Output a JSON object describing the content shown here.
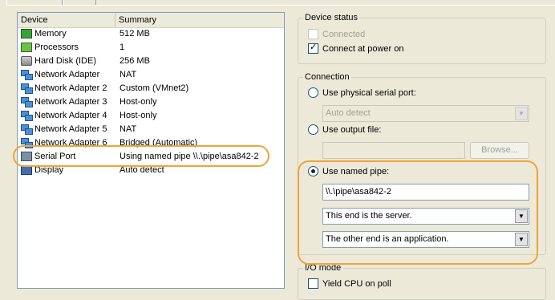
{
  "device_list": {
    "columns": [
      "Device",
      "Summary"
    ],
    "rows": [
      {
        "device": "Memory",
        "summary": "512 MB",
        "icon": "memory-icon"
      },
      {
        "device": "Processors",
        "summary": "1",
        "icon": "processor-icon"
      },
      {
        "device": "Hard Disk (IDE)",
        "summary": "256 MB",
        "icon": "hard-disk-icon"
      },
      {
        "device": "Network Adapter",
        "summary": "NAT",
        "icon": "network-adapter-icon"
      },
      {
        "device": "Network Adapter 2",
        "summary": "Custom (VMnet2)",
        "icon": "network-adapter-icon"
      },
      {
        "device": "Network Adapter 3",
        "summary": "Host-only",
        "icon": "network-adapter-icon"
      },
      {
        "device": "Network Adapter 4",
        "summary": "Host-only",
        "icon": "network-adapter-icon"
      },
      {
        "device": "Network Adapter 5",
        "summary": "NAT",
        "icon": "network-adapter-icon"
      },
      {
        "device": "Network Adapter 6",
        "summary": "Bridged (Automatic)",
        "icon": "network-adapter-icon"
      },
      {
        "device": "Serial Port",
        "summary": "Using named pipe \\\\.\\pipe\\asa842-2",
        "icon": "serial-port-icon"
      },
      {
        "device": "Display",
        "summary": "Auto detect",
        "icon": "display-icon"
      }
    ]
  },
  "device_status": {
    "title": "Device status",
    "connected_label": "Connected",
    "connected_checked": false,
    "connected_enabled": false,
    "power_on_label": "Connect at power on",
    "power_on_checked": true
  },
  "connection": {
    "title": "Connection",
    "physical_label": "Use physical serial port:",
    "physical_value": "Auto detect",
    "output_label": "Use output file:",
    "output_value": "",
    "browse_label": "Browse...",
    "pipe_label": "Use named pipe:",
    "pipe_selected": true,
    "pipe_name": "\\\\.\\pipe\\asa842-2",
    "end_server": "This end is the server.",
    "other_end": "The other end is an application."
  },
  "io_mode": {
    "title": "I/O mode",
    "yield_label": "Yield CPU on poll",
    "yield_checked": false
  },
  "colors": {
    "highlight": "#f0a33a",
    "background": "#ece9d8"
  }
}
